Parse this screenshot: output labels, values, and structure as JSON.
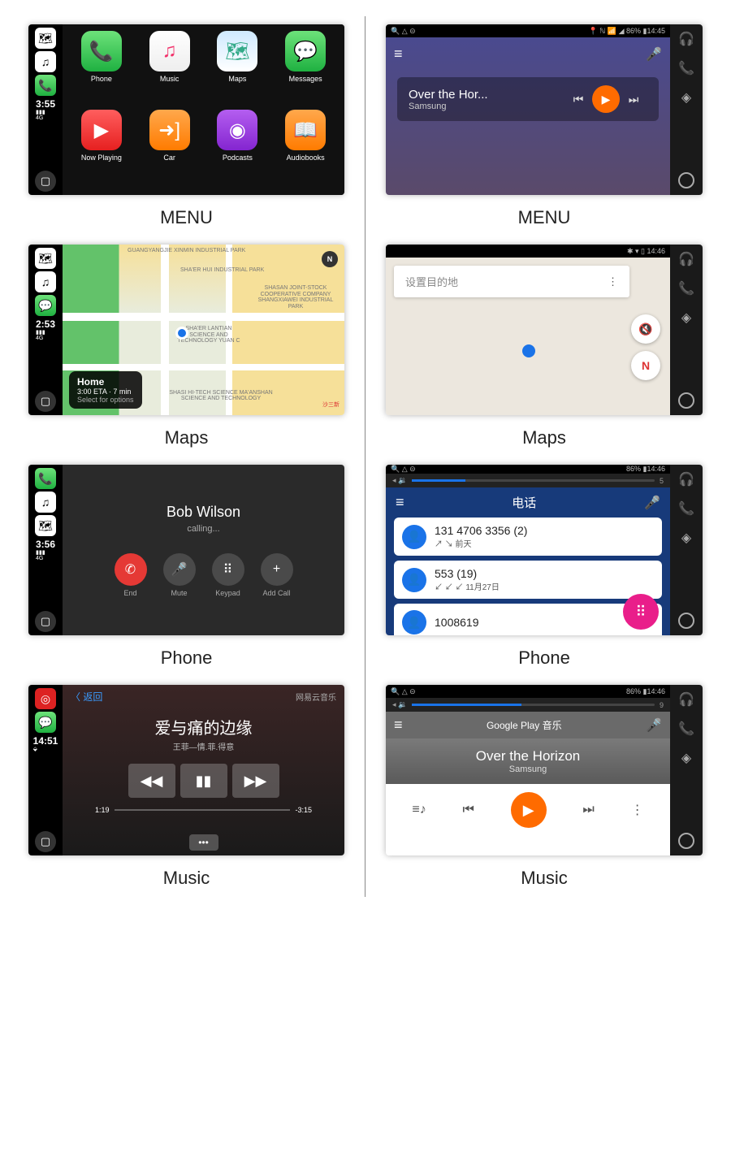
{
  "captions": {
    "menu": "MENU",
    "maps": "Maps",
    "phone": "Phone",
    "music": "Music"
  },
  "cp": {
    "times": {
      "menu": "3:55",
      "maps": "2:53",
      "phone": "3:56",
      "music": "14:51"
    },
    "net": "4G",
    "apps": [
      {
        "label": "Phone",
        "icon": "📞",
        "cls": "g-green"
      },
      {
        "label": "Music",
        "icon": "♫",
        "cls": "g-pink"
      },
      {
        "label": "Maps",
        "icon": "🗺",
        "cls": "g-map"
      },
      {
        "label": "Messages",
        "icon": "💬",
        "cls": "g-green"
      },
      {
        "label": "Now Playing",
        "icon": "▶",
        "cls": "g-red"
      },
      {
        "label": "Car",
        "icon": "➜]",
        "cls": "g-orange"
      },
      {
        "label": "Podcasts",
        "icon": "◉",
        "cls": "g-purple"
      },
      {
        "label": "Audiobooks",
        "icon": "📖",
        "cls": "g-orange"
      }
    ],
    "map": {
      "north": "N",
      "home": "Home",
      "eta": "3:00 ETA · 7 min",
      "sub": "Select for options",
      "labels": [
        "GUANGYANGJIE XINMIN INDUSTRIAL PARK",
        "SHA'ER HUI INDUSTRIAL PARK",
        "SHASAN JOINT-STOCK COOPERATIVE COMPANY SHANGXIAWEI INDUSTRIAL PARK",
        "SHA'ER LANTIAN SCIENCE AND TECHNOLOGY YUAN C",
        "SHASI HI-TECH SCIENCE MA'ANSHAN SCIENCE AND TECHNOLOGY",
        "沙三新"
      ]
    },
    "phone": {
      "name": "Bob Wilson",
      "status": "calling...",
      "btns": [
        {
          "l": "End",
          "i": "✆"
        },
        {
          "l": "Mute",
          "i": "🎤"
        },
        {
          "l": "Keypad",
          "i": "⠿"
        },
        {
          "l": "Add Call",
          "i": "+"
        }
      ]
    },
    "music": {
      "back": "〈 返回",
      "src": "网易云音乐",
      "title": "爱与痛的边缘",
      "sub": "王菲—情.菲.得意",
      "elapsed": "1:19",
      "remain": "-3:15",
      "redIcon": "◎"
    }
  },
  "aa": {
    "status": {
      "left": "🔍 △ ⊝",
      "right1": "📍 ℕ 📶 ◢ 86% ▮14:45",
      "right2": "✱ ▾ ▯  14:46",
      "right3": "86% ▮14:46",
      "right4": "86% ▮14:46",
      "vol": "◂ 🔉",
      "volR": "5",
      "volR2": "9"
    },
    "side": [
      "🎧",
      "📞",
      "◈"
    ],
    "menu": {
      "track": "Over the Hor...",
      "artist": "Samsung"
    },
    "map": {
      "search": "设置目的地",
      "compass": "N",
      "mute": "🔇"
    },
    "phone": {
      "title": "电话",
      "rows": [
        {
          "num": "131 4706 3356 (2)",
          "meta": "↗ ↘ 前天",
          "dir": "io"
        },
        {
          "num": "553 (19)",
          "meta": "↙ ↙ ↙ 11月27日",
          "dir": "in"
        },
        {
          "num": "1008619",
          "meta": "",
          "dir": ""
        }
      ]
    },
    "music": {
      "hdr": "Google Play 音乐",
      "title": "Over the Horizon",
      "artist": "Samsung"
    }
  }
}
